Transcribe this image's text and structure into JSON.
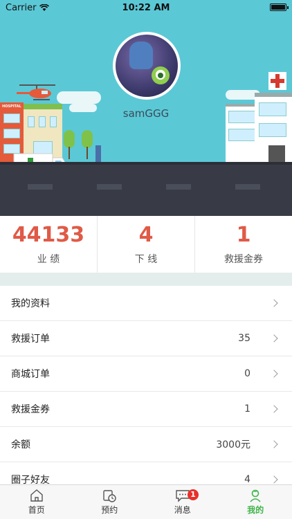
{
  "status_bar": {
    "carrier": "Carrier",
    "time": "10:22 AM"
  },
  "profile": {
    "username": "samGGG"
  },
  "hospital_sign": "HOSPITAL",
  "stats": [
    {
      "value": "44133",
      "label": "业 绩"
    },
    {
      "value": "4",
      "label": "下 线"
    },
    {
      "value": "1",
      "label": "救援金券"
    }
  ],
  "menu": [
    {
      "label": "我的资料",
      "value": ""
    },
    {
      "label": "救援订单",
      "value": "35"
    },
    {
      "label": "商城订单",
      "value": "0"
    },
    {
      "label": "救援金券",
      "value": "1"
    },
    {
      "label": "余额",
      "value": "3000元"
    },
    {
      "label": "圈子好友",
      "value": "4"
    }
  ],
  "tabs": [
    {
      "label": "首页",
      "icon": "home-icon"
    },
    {
      "label": "预约",
      "icon": "calendar-clock-icon"
    },
    {
      "label": "消息",
      "icon": "message-icon",
      "badge": "1"
    },
    {
      "label": "我的",
      "icon": "user-icon",
      "active": true
    }
  ],
  "colors": {
    "accent": "#e05a47",
    "header_bg": "#5bc8d6",
    "active_tab": "#3fb449",
    "badge": "#e8302a"
  }
}
